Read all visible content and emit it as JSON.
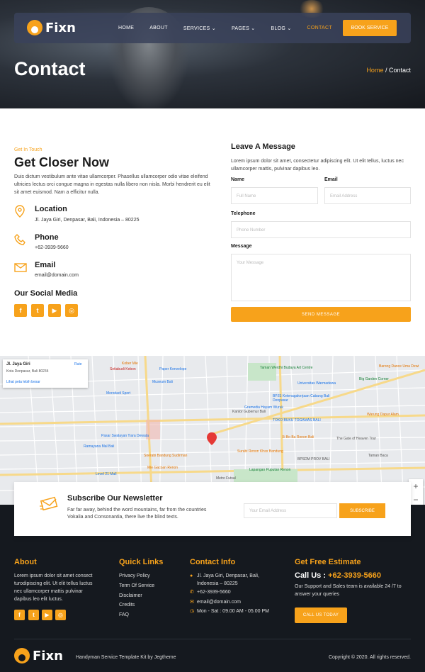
{
  "brand": {
    "name": "Fixn",
    "accent": "#f7a21b",
    "dark": "#15191f"
  },
  "nav": {
    "items": [
      "HOME",
      "ABOUT",
      "SERVICES",
      "PAGES",
      "BLOG",
      "CONTACT"
    ],
    "dropdown_flags": [
      false,
      false,
      true,
      true,
      true,
      false
    ],
    "active": "CONTACT",
    "book_label": "BOOK SERVICE"
  },
  "hero": {
    "title": "Contact",
    "crumb_home": "Home",
    "crumb_sep": " / ",
    "crumb_current": "Contact"
  },
  "contact": {
    "eyebrow": "Get In Touch",
    "title": "Get Closer Now",
    "intro": "Duis dictum vestibulum ante vitae ullamcorper. Phasellus ullamcorper odio vitae eleifend ultricies lectus orci congue magna in egestas nulla libero non nisla. Morbi hendrerit eu elit sit amet euismod. Nam a efficitur nulla.",
    "location": {
      "heading": "Location",
      "text": "Jl. Jaya Giri, Denpasar, Bali, Indonesia – 80225",
      "icon": "map-pin-icon"
    },
    "phone": {
      "heading": "Phone",
      "text": "+62-3939-5660",
      "icon": "phone-icon"
    },
    "email": {
      "heading": "Email",
      "text": "email@domain.com",
      "icon": "envelope-icon"
    },
    "social_heading": "Our Social Media",
    "social": [
      "f",
      "t",
      "▶",
      "◎"
    ]
  },
  "form": {
    "heading": "Leave A Message",
    "intro": "Lorem ipsum dolor sit amet, consectetur adipiscing elit. Ut elit tellus, luctus nec ullamcorper mattis, pulvinar dapibus leo.",
    "name_label": "Name",
    "name_placeholder": "Full Name",
    "email_label": "Email",
    "email_placeholder": "Email Address",
    "phone_label": "Telephone",
    "phone_placeholder": "Phone Number",
    "message_label": "Message",
    "message_placeholder": "Your Message",
    "send_label": "SEND MESSAGE"
  },
  "map": {
    "card_title": "Jl. Jaya Giri",
    "card_sub": "Kota Denpasar, Bali 80234",
    "card_link": "Lihat peta lebih besar",
    "card_route": "Rute",
    "zoom_in": "+",
    "zoom_out": "−",
    "labels": [
      "Kober Mie",
      "Setiabudi Kebon",
      "Paper Kenvelope",
      "Taman Werdhi Budaya Art Centre",
      "Barong Dance Uma Dewi",
      "Museum Bali",
      "Universitas Warmadewa",
      "Big Garden Corner",
      "Morodadi Sport",
      "BPJS Ketenagakerjaan Cabang Bali Denpasar",
      "Gramedia Hayam Wuruk",
      "Pasar Swalayan Tiara Dewata",
      "Kantor Gubernur Bali",
      "TOKO BUKU TOGAMAS BALI",
      "Warung Dapur Alam",
      "Ramayana Mal Bali",
      "Xi Bo Ba Renon Bali",
      "The Gate of Heaven Tour",
      "Soerabi Bandung Sudirman",
      "Surabi Renon Khas Bandung",
      "BPSDM PROV BALI",
      "Taman Baca",
      "Mie Gacoan Renon",
      "Level 21 Mall",
      "Lapangan Puputan Renon",
      "Metro Futsal"
    ]
  },
  "newsletter": {
    "heading": "Subscribe Our Newsletter",
    "text": "Far far away, behind the word mountains, far from the countries Vokalia and Consonantia, there live the blind texts.",
    "placeholder": "Your Email Address",
    "button": "SUBSCRIBE"
  },
  "footer": {
    "about_heading": "About",
    "about_text": "Lorem ipsum dolor sit amet consect turodipiscing elit. Ut elit tellus luctus nec ullamcorper mattis pulvinar dapibus leo elit luctus.",
    "links_heading": "Quick Links",
    "links": [
      "Privacy Policy",
      "Term Of Service",
      "Disclaimer",
      "Credits",
      "FAQ"
    ],
    "contact_heading": "Contact Info",
    "contact_address": "Jl. Jaya Giri, Denpasar, Bali, Indonesia – 80225",
    "contact_phone": "+62-3939-5660",
    "contact_email": "email@domain.com",
    "contact_hours": "Mon - Sat : 09.00 AM - 05.00 PM",
    "estimate_heading": "Get Free Estimate",
    "call_label": "Call Us : ",
    "call_number": "+62-3939-5660",
    "estimate_text": "Our Support and Sales team is available 24 /7 to answer your queries",
    "call_button": "CALL US TODAY",
    "kit_credit": "Handyman Service Template Kit by Jegtheme",
    "copyright": "Copyright © 2020. All rights reserved."
  }
}
